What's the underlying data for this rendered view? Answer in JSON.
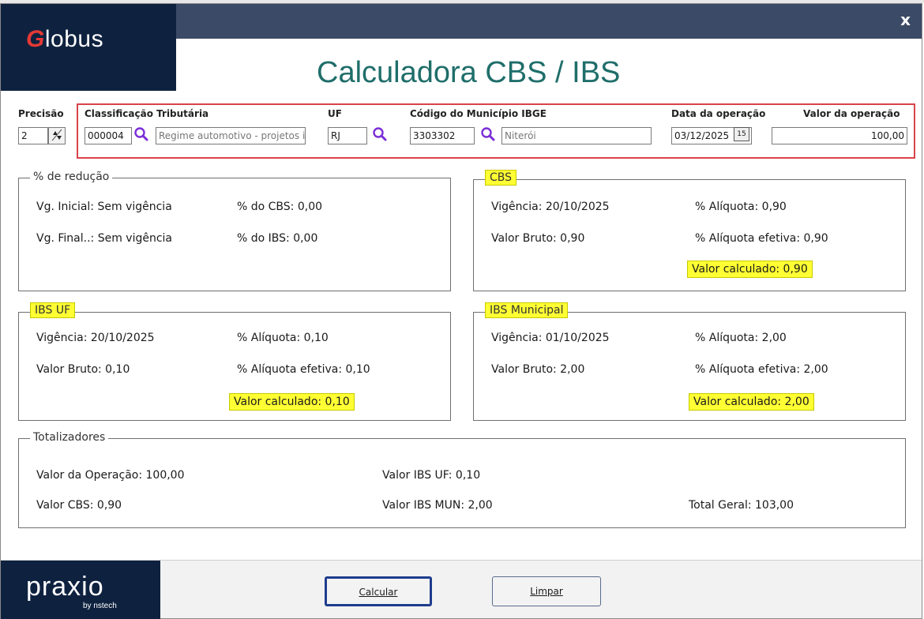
{
  "window": {
    "close_label": "x"
  },
  "brand": {
    "logo_g": "G",
    "logo_rest": "lobus",
    "footer_logo": "praxio",
    "footer_sub": "by nstech"
  },
  "title": "Calculadora CBS / IBS",
  "form": {
    "precisao_label": "Precisão",
    "precisao_value": "2",
    "classificacao_label": "Classificação Tributária",
    "classificacao_code": "000004",
    "classificacao_desc": "Regime automotivo - projetos ir",
    "uf_label": "UF",
    "uf_value": "RJ",
    "municipio_label": "Código do Município IBGE",
    "municipio_code": "3303302",
    "municipio_name": "Niterói",
    "data_label": "Data da operação",
    "data_value": "03/12/2025",
    "valor_label": "Valor da operação",
    "valor_value": "100,00"
  },
  "reducao": {
    "title": "% de redução",
    "vg_inicial": "Vg. Inicial:  Sem vigência",
    "vg_final": "Vg. Final..:  Sem vigência",
    "pct_cbs": "% do CBS: 0,00",
    "pct_ibs": "% do IBS: 0,00"
  },
  "cbs": {
    "title": "CBS",
    "vigencia": "Vigência: 20/10/2025",
    "aliquota": "% Alíquota: 0,90",
    "valor_bruto": "Valor Bruto: 0,90",
    "aliquota_efetiva": "% Alíquota efetiva: 0,90",
    "valor_calculado": "Valor calculado: 0,90"
  },
  "ibs_uf": {
    "title": "IBS UF",
    "vigencia": "Vigência: 20/10/2025",
    "aliquota": "% Alíquota: 0,10",
    "valor_bruto": "Valor Bruto: 0,10",
    "aliquota_efetiva": "% Alíquota efetiva: 0,10",
    "valor_calculado": "Valor calculado: 0,10"
  },
  "ibs_mun": {
    "title": "IBS Municipal",
    "vigencia": "Vigência: 01/10/2025",
    "aliquota": "% Alíquota: 2,00",
    "valor_bruto": "Valor Bruto: 2,00",
    "aliquota_efetiva": "% Alíquota efetiva: 2,00",
    "valor_calculado": "Valor calculado: 2,00"
  },
  "totais": {
    "title": "Totalizadores",
    "valor_operacao": "Valor da Operação: 100,00",
    "valor_cbs": "Valor CBS: 0,90",
    "valor_ibs_uf": "Valor IBS UF: 0,10",
    "valor_ibs_mun": "Valor IBS MUN: 2,00",
    "total_geral": "Total Geral: 103,00"
  },
  "buttons": {
    "calcular": "Calcular",
    "limpar": "Limpar"
  },
  "colors": {
    "highlight": "#ffff33",
    "title_teal": "#1f6e6a",
    "red_box": "#d9434a",
    "search_icon": "#7b2fd6"
  },
  "icons": {
    "search": "search-icon",
    "calendar": "calendar-icon",
    "spinner": "spinner-icon"
  }
}
